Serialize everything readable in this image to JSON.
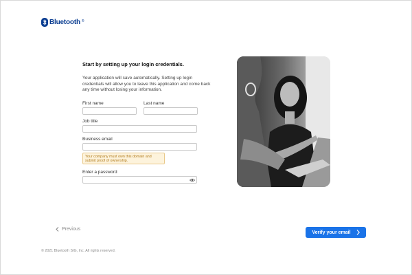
{
  "brand": {
    "name": "Bluetooth",
    "trademark": "®",
    "color": "#0a3d91"
  },
  "form": {
    "heading": "Start by setting up your login credentials.",
    "intro": "Your application will save automatically. Setting up login credentials will allow you to leave this application and come back any time without losing your information.",
    "first_name": {
      "label": "First name",
      "value": ""
    },
    "last_name": {
      "label": "Last name",
      "value": ""
    },
    "job_title": {
      "label": "Job title",
      "value": ""
    },
    "business_email": {
      "label": "Business email",
      "value": "",
      "warning": "Your company must own this domain and submit proof of ownership."
    },
    "password": {
      "label": "Enter a password",
      "value": ""
    }
  },
  "nav": {
    "previous_label": "Previous",
    "verify_label": "Verify your email",
    "accent_color": "#1a73e8"
  },
  "icons": {
    "logo": "bluetooth-rune-icon",
    "password_toggle": "eye-icon",
    "previous": "chevron-left-icon",
    "next": "chevron-right-icon"
  },
  "footer": {
    "copyright": "© 2021 Bluetooth SIG, Inc. All rights reserved."
  }
}
